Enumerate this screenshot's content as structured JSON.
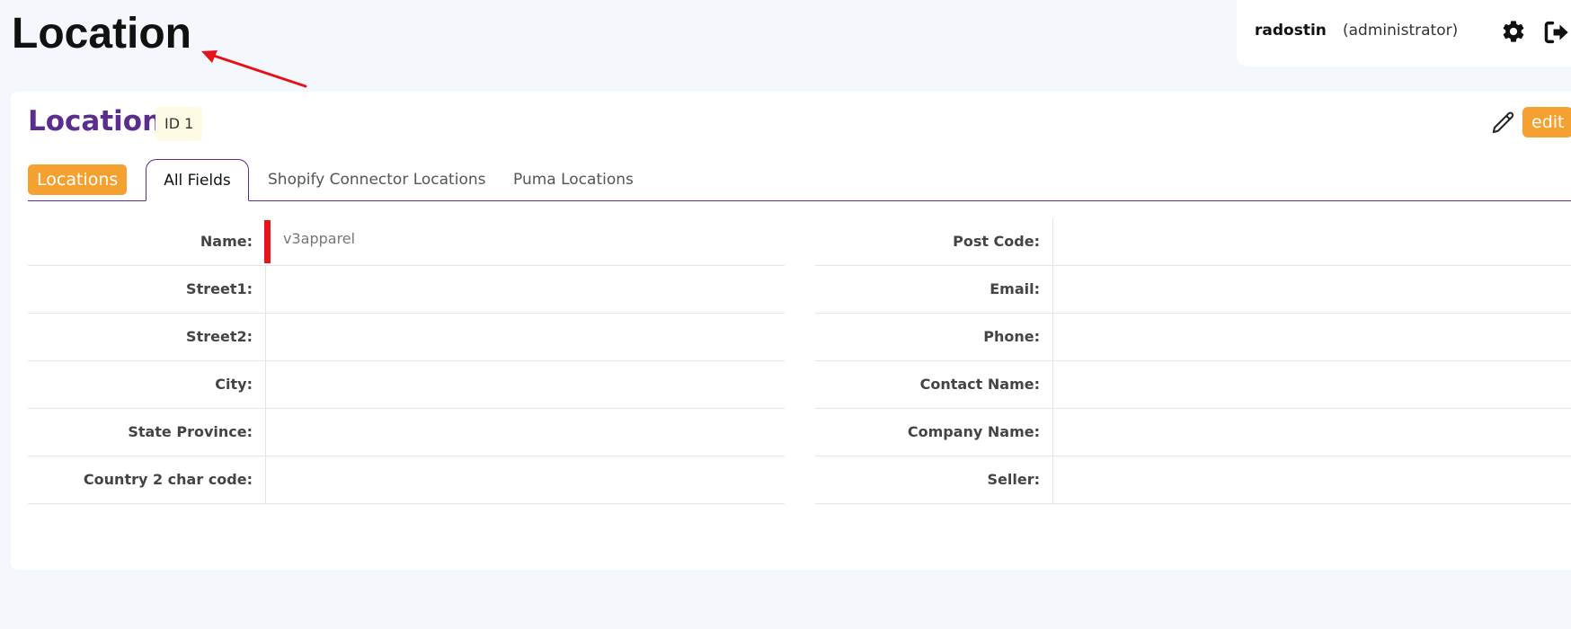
{
  "page_title": "Location",
  "user": {
    "name": "radostin",
    "role": "(administrator)"
  },
  "card": {
    "title": "Location",
    "id_badge": "ID 1",
    "edit_label": "edit",
    "locations_button": "Locations"
  },
  "tabs": [
    {
      "label": "All Fields",
      "active": true
    },
    {
      "label": "Shopify Connector Locations",
      "active": false
    },
    {
      "label": "Puma Locations",
      "active": false
    }
  ],
  "fields_left": [
    {
      "label": "Name:",
      "value": "v3apparel",
      "required": true
    },
    {
      "label": "Street1:",
      "value": ""
    },
    {
      "label": "Street2:",
      "value": ""
    },
    {
      "label": "City:",
      "value": ""
    },
    {
      "label": "State Province:",
      "value": ""
    },
    {
      "label": "Country 2 char code:",
      "value": ""
    }
  ],
  "fields_right": [
    {
      "label": "Post Code:",
      "value": ""
    },
    {
      "label": "Email:",
      "value": ""
    },
    {
      "label": "Phone:",
      "value": ""
    },
    {
      "label": "Contact Name:",
      "value": ""
    },
    {
      "label": "Company Name:",
      "value": ""
    },
    {
      "label": "Seller:",
      "value": ""
    }
  ],
  "icons": {
    "settings": "gear-icon",
    "logout": "logout-icon",
    "edit": "pencil-icon",
    "annotation": "red-arrow-icon"
  },
  "colors": {
    "accent_orange": "#f5a132",
    "title_purple": "#5b2d8e",
    "required_red": "#e5141b",
    "annotation_red": "#e5141b",
    "badge_bg": "#fdfbe3",
    "page_bg": "#f4f8fc"
  }
}
